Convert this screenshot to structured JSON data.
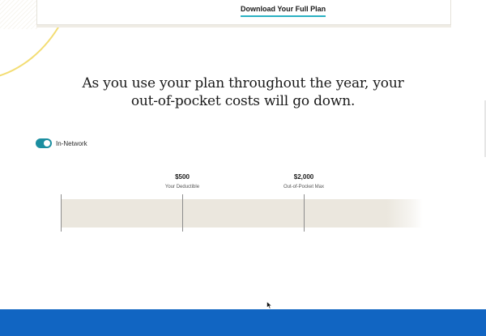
{
  "top_card": {
    "download_label": "Download Your Full Plan"
  },
  "headline": {
    "line1": "As you use your plan throughout the year, your",
    "line2": "out-of-pocket costs will go down."
  },
  "network_toggle": {
    "label": "In-Network",
    "enabled": true,
    "color": "#1b8ea0"
  },
  "cost_tracker": {
    "deductible": {
      "amount": "$500",
      "caption": "Your Deductible"
    },
    "out_of_pocket_max": {
      "amount": "$2,000",
      "caption": "Out-of-Pocket Max"
    }
  },
  "colors": {
    "accent_underline": "#2ab0c2",
    "bar_fill": "#ebe7de",
    "footer_band": "#1165c2",
    "decor_arc": "#f3dd73"
  }
}
